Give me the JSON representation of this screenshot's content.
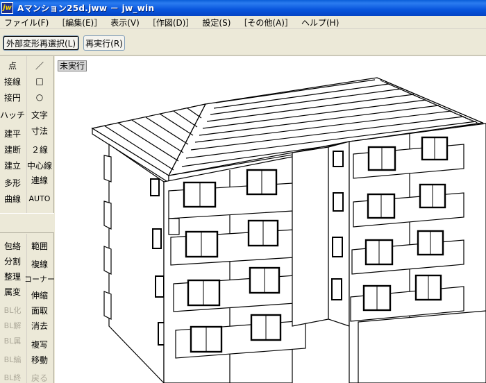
{
  "window": {
    "title": "Aマンション25d.jww － jw_win",
    "app_icon": "jw"
  },
  "menu": [
    "ファイル(F)",
    "［編集(E)］",
    "表示(V)",
    "［作図(D)］",
    "設定(S)",
    "［その他(A)］",
    "ヘルプ(H)"
  ],
  "toolbar": {
    "reselect_label": "外部変形再選択(L)",
    "rerun_label": "再実行(R)"
  },
  "canvas": {
    "status": "未実行"
  },
  "left_panel": {
    "top_left": [
      "点",
      "接線",
      "接円",
      "ハッチ",
      "建平",
      "建断",
      "建立",
      "多形",
      "曲線"
    ],
    "top_right": [
      "／",
      "□",
      "○",
      "文字",
      "寸法",
      "２線",
      "中心線",
      "連線",
      "AUTO"
    ],
    "bottom_left": [
      "包絡",
      "分割",
      "整理",
      "属変",
      "BL化",
      "BL解",
      "BL属",
      "BL編",
      "BL終"
    ],
    "bottom_right": [
      "範囲",
      "複線",
      "コーナー",
      "伸縮",
      "面取",
      "消去",
      "複写",
      "移動",
      "戻る"
    ]
  },
  "colors": {
    "titlebar": "#0855dd",
    "panel": "#ece9d8",
    "canvas": "#ffffff",
    "disabled": "#aca899"
  }
}
